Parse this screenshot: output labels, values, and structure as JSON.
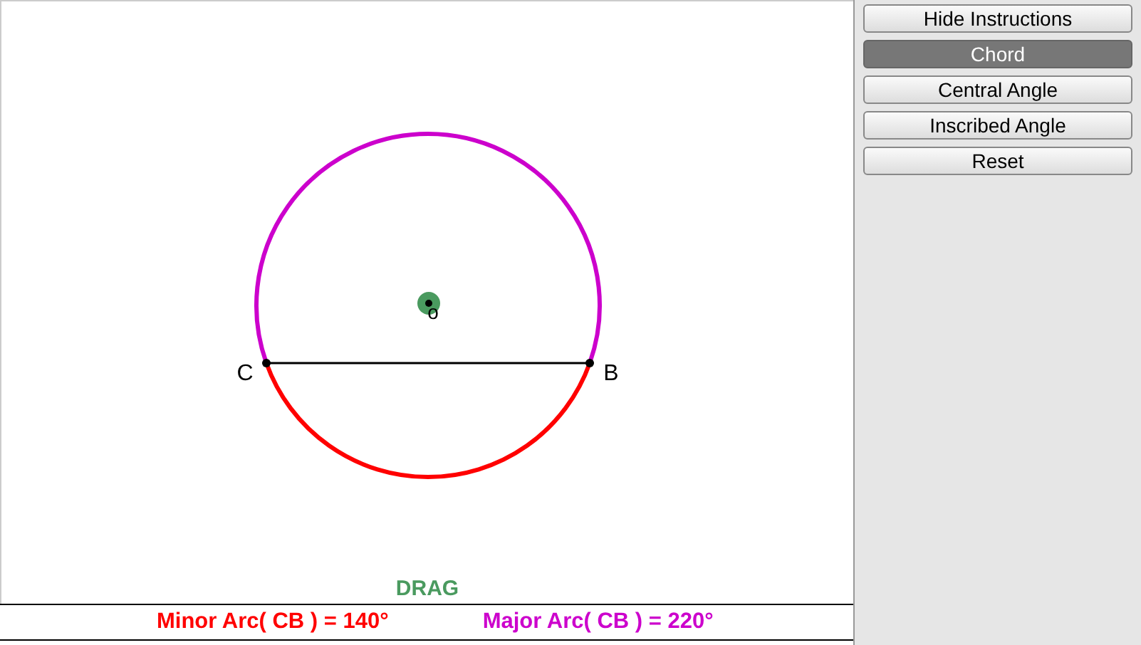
{
  "canvas": {
    "points": [
      {
        "kind": "center",
        "label": "o"
      },
      {
        "kind": "left",
        "label": "C"
      },
      {
        "kind": "right",
        "label": "B"
      }
    ],
    "arcs": [
      {
        "kind": "minor",
        "color": "#ff0000"
      },
      {
        "kind": "major",
        "color": "#cc00cc"
      }
    ],
    "drag_label": "DRAG"
  },
  "measurements": [
    {
      "text": "Minor Arc( CB ) = 140°",
      "color": "#ff0000"
    },
    {
      "text": "Major Arc( CB ) = 220°",
      "color": "#cc00cc"
    }
  ],
  "buttons": [
    {
      "label": "Hide Instructions",
      "selected": false
    },
    {
      "label": "Chord",
      "selected": true
    },
    {
      "label": "Central Angle",
      "selected": false
    },
    {
      "label": "Inscribed Angle",
      "selected": false
    },
    {
      "label": "Reset",
      "selected": false
    }
  ]
}
